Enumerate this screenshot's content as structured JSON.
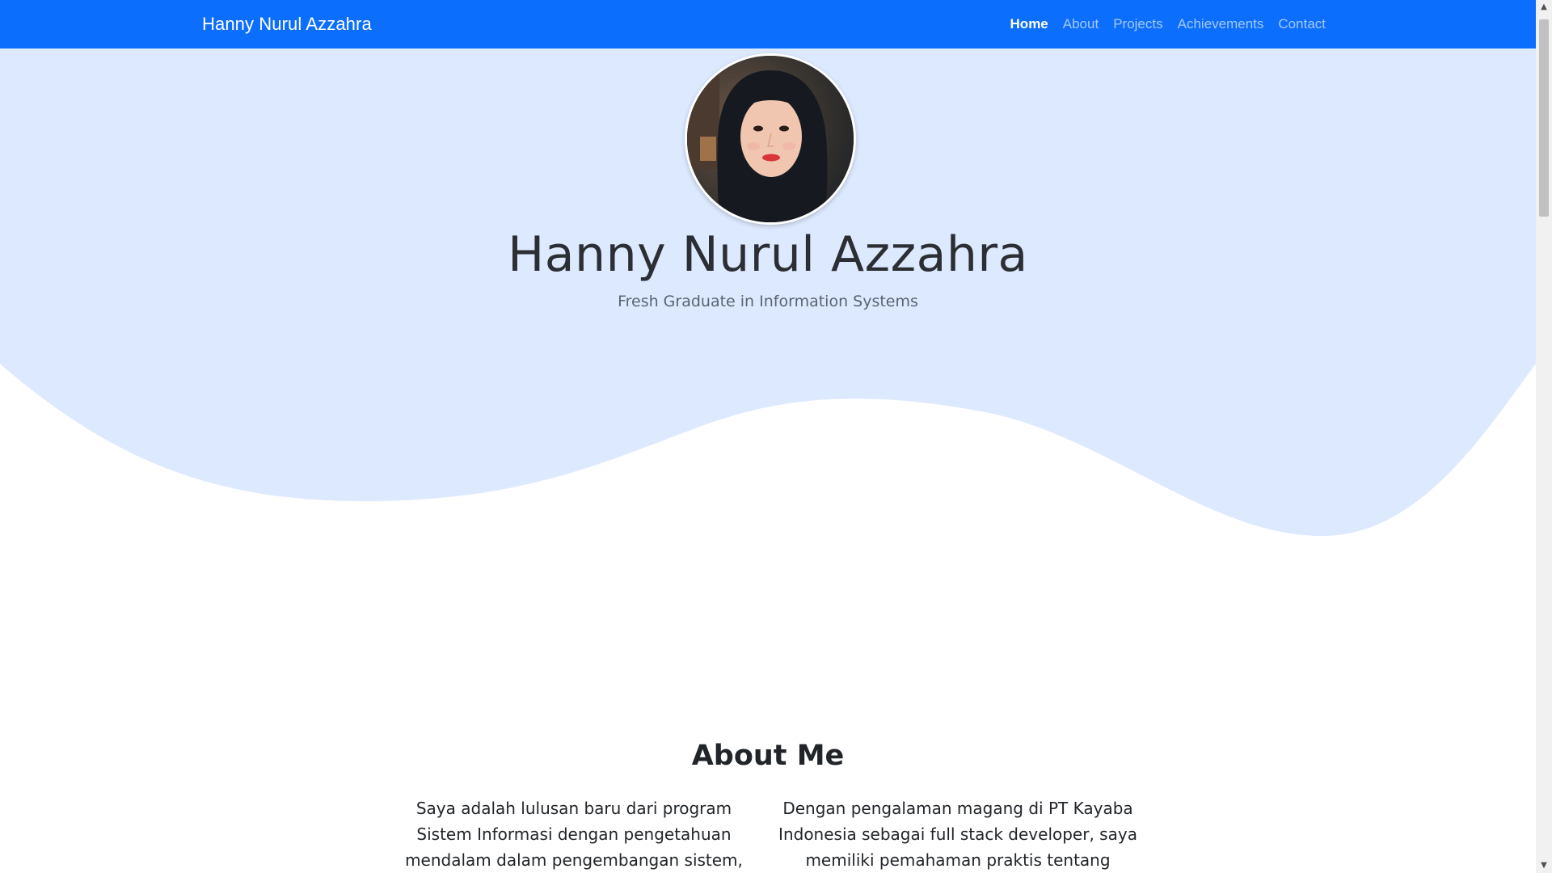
{
  "navbar": {
    "brand": "Hanny Nurul Azzahra",
    "links": [
      {
        "label": "Home",
        "active": true
      },
      {
        "label": "About",
        "active": false
      },
      {
        "label": "Projects",
        "active": false
      },
      {
        "label": "Achievements",
        "active": false
      },
      {
        "label": "Contact",
        "active": false
      }
    ]
  },
  "hero": {
    "name": "Hanny Nurul Azzahra",
    "subtitle": "Fresh Graduate in Information Systems",
    "avatar_icon": "profile-photo"
  },
  "about": {
    "title": "About Me",
    "left_text": "Saya adalah lulusan baru dari program Sistem Informasi dengan pengetahuan mendalam dalam pengembangan sistem, manajemen",
    "right_text": "Dengan pengalaman magang di PT Kayaba Indonesia sebagai full stack developer, saya memiliki pemahaman praktis tentang"
  },
  "colors": {
    "navbar": "#0b6efd",
    "hero_bg": "#dde9ff",
    "text_dark": "#212529",
    "text_muted": "#5a6570"
  }
}
